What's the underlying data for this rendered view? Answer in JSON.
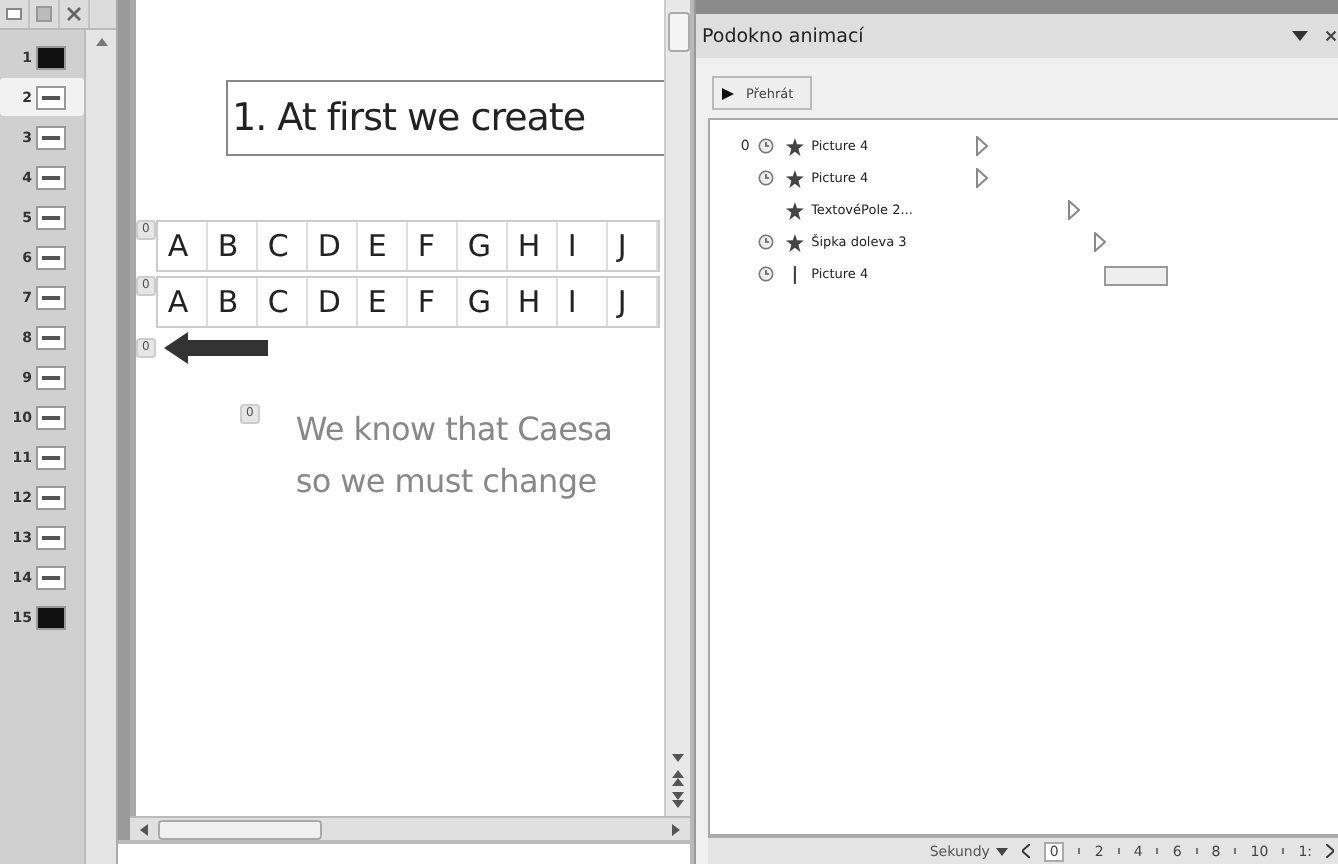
{
  "slides_panel": {
    "slides": [
      {
        "number": "1",
        "selected": false,
        "kind": "dark"
      },
      {
        "number": "2",
        "selected": true,
        "kind": "light"
      },
      {
        "number": "3",
        "selected": false,
        "kind": "light"
      },
      {
        "number": "4",
        "selected": false,
        "kind": "light"
      },
      {
        "number": "5",
        "selected": false,
        "kind": "light"
      },
      {
        "number": "6",
        "selected": false,
        "kind": "light"
      },
      {
        "number": "7",
        "selected": false,
        "kind": "light"
      },
      {
        "number": "8",
        "selected": false,
        "kind": "light"
      },
      {
        "number": "9",
        "selected": false,
        "kind": "light"
      },
      {
        "number": "10",
        "selected": false,
        "kind": "light"
      },
      {
        "number": "11",
        "selected": false,
        "kind": "light"
      },
      {
        "number": "12",
        "selected": false,
        "kind": "light"
      },
      {
        "number": "13",
        "selected": false,
        "kind": "light"
      },
      {
        "number": "14",
        "selected": false,
        "kind": "light"
      },
      {
        "number": "15",
        "selected": false,
        "kind": "dark"
      }
    ]
  },
  "slide": {
    "title": "1. At first we create",
    "table_rows": [
      {
        "tag": "0",
        "cells": [
          "A",
          "B",
          "C",
          "D",
          "E",
          "F",
          "G",
          "H",
          "I",
          "J"
        ]
      },
      {
        "tag": "0",
        "cells": [
          "A",
          "B",
          "C",
          "D",
          "E",
          "F",
          "G",
          "H",
          "I",
          "J"
        ]
      }
    ],
    "arrow_tag": "0",
    "body_tag": "0",
    "body_lines": [
      "We know that Caesa",
      "so we must change"
    ]
  },
  "animation_pane": {
    "title": "Podokno animací",
    "play_button": "Přehrát",
    "items": [
      {
        "number": "0",
        "clock": true,
        "kind": "star",
        "name": "Picture 4"
      },
      {
        "clock": true,
        "kind": "star",
        "name": "Picture 4"
      },
      {
        "clock": false,
        "kind": "star",
        "name": "TextovéPole 2..."
      },
      {
        "clock": true,
        "kind": "star",
        "name": "Šipka doleva 3"
      },
      {
        "clock": true,
        "kind": "line",
        "name": "Picture 4"
      }
    ],
    "timeline": {
      "unit": "Sekundy",
      "ticks": [
        "0",
        "2",
        "4",
        "6",
        "8",
        "10",
        "1:"
      ]
    }
  }
}
